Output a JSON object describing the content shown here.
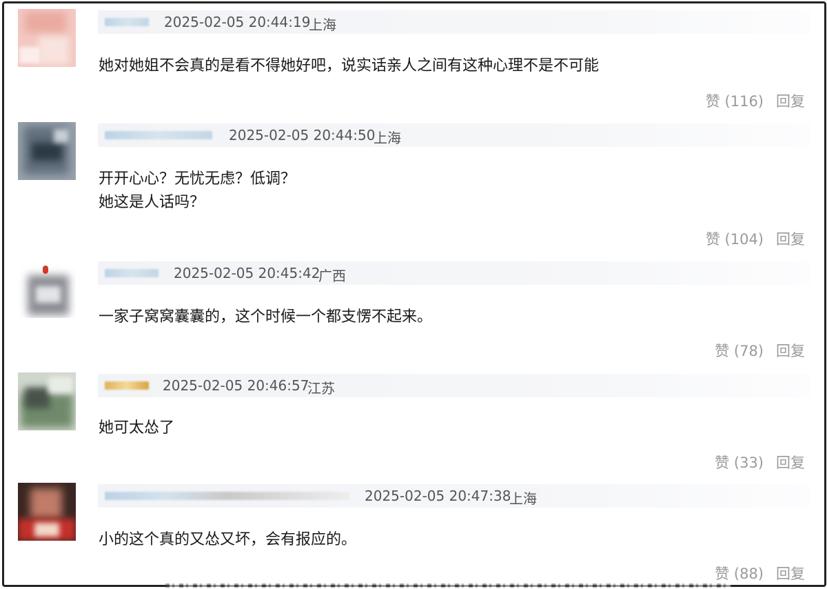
{
  "comments": [
    {
      "timestamp": "2025-02-05 20:44:19",
      "location": "上海",
      "lines": [
        "她对她姐不会真的是看不得她好吧，说实话亲人之间有这种心理不是不可能"
      ],
      "like_label": "赞",
      "like_count": "(116)",
      "reply_label": "回复"
    },
    {
      "timestamp": "2025-02-05 20:44:50",
      "location": "上海",
      "lines": [
        "开开心心？无忧无虑？低调？",
        "她这是人话吗？"
      ],
      "like_label": "赞",
      "like_count": "(104)",
      "reply_label": "回复"
    },
    {
      "timestamp": "2025-02-05 20:45:42",
      "location": "广西",
      "lines": [
        "一家子窝窝囊囊的，这个时候一个都支愣不起来。"
      ],
      "like_label": "赞",
      "like_count": "(78)",
      "reply_label": "回复"
    },
    {
      "timestamp": "2025-02-05 20:46:57",
      "location": "江苏",
      "lines": [
        "她可太怂了"
      ],
      "like_label": "赞",
      "like_count": "(33)",
      "reply_label": "回复"
    },
    {
      "timestamp": "2025-02-05 20:47:38",
      "location": "上海",
      "lines": [
        "小的这个真的又怂又坏，会有报应的。"
      ],
      "like_label": "赞",
      "like_count": "(88)",
      "reply_label": "回复"
    }
  ],
  "colors": {
    "frame_border": "#222222",
    "meta_bar": "#f1f3f6",
    "meta_text": "#555555",
    "body_text": "#1a1a1a",
    "action_text": "#9a9a9a"
  },
  "icons": [
    "avatar"
  ]
}
